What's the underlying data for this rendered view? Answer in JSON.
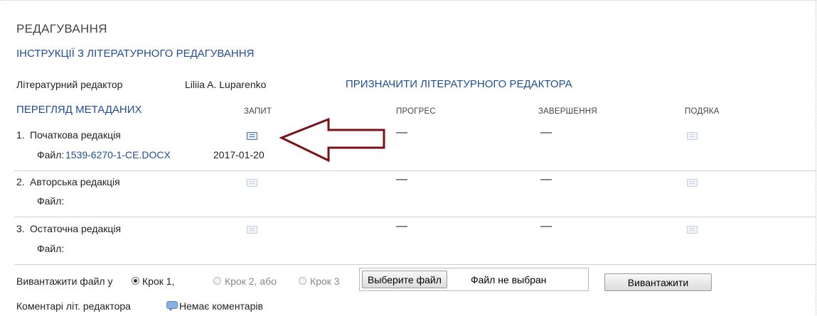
{
  "header": {
    "title": "РЕДАГУВАННЯ",
    "instructions_link": "ІНСТРУКЦІЇ З ЛІТЕРАТУРНОГО РЕДАГУВАННЯ"
  },
  "editor": {
    "label": "Літературний редактор",
    "name": "Liliia A. Luparenko",
    "assign_link": "ПРИЗНАЧИТИ ЛІТЕРАТУРНОГО РЕДАКТОРА"
  },
  "metadata_link": "ПЕРЕГЛЯД МЕТАДАНИХ",
  "columns": {
    "request": "ЗАПИТ",
    "progress": "ПРОГРЕС",
    "completion": "ЗАВЕРШЕННЯ",
    "thanks": "ПОДЯКА"
  },
  "rows": [
    {
      "num": "1.",
      "label": "Початкова редакція",
      "file_label": "Файл:",
      "file_name": "1539-6270-1-CE.DOCX",
      "file_date": "2017-01-20",
      "progress": "—",
      "completion": "—"
    },
    {
      "num": "2.",
      "label": "Авторська редакція",
      "file_label": "Файл:",
      "progress": "—",
      "completion": "—"
    },
    {
      "num": "3.",
      "label": "Остаточна редакція",
      "file_label": "Файл:",
      "progress": "—",
      "completion": "—"
    }
  ],
  "upload": {
    "prefix": "Вивантажити файл у",
    "step1": "Крок 1,",
    "step2": "Крок 2, або",
    "step3": "Крок 3",
    "selected_step": 1,
    "choose_button": "Выберите файл",
    "no_file": "Файл не выбран",
    "upload_button": "Вивантажити"
  },
  "comments": {
    "label": "Коментарі літ. редактора",
    "value": "Немає коментарів"
  },
  "colors": {
    "link": "#1f4e96",
    "annotation_arrow": "#7a1018"
  },
  "icons": [
    "mail-icon",
    "comment-icon",
    "arrow-annotation"
  ]
}
